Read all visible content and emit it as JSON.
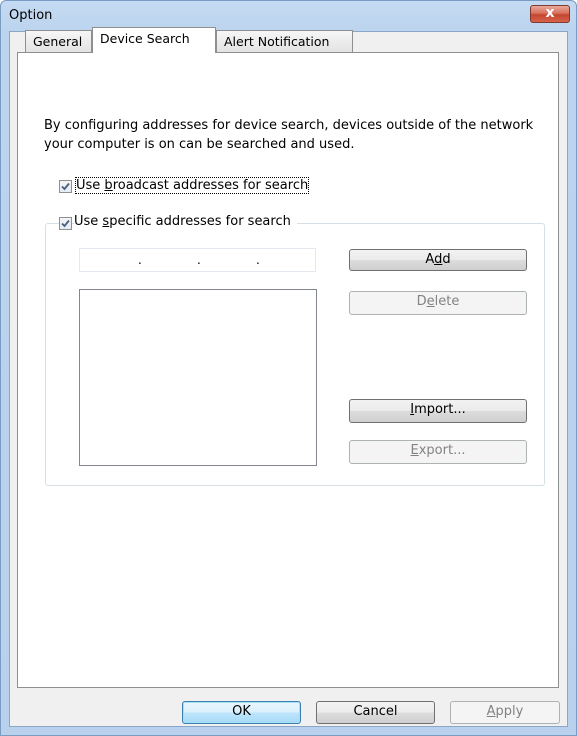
{
  "window": {
    "title": "Option",
    "close_glyph": "x"
  },
  "tabs": [
    {
      "label": "General"
    },
    {
      "label": "Device Search"
    },
    {
      "label": "Alert Notification"
    }
  ],
  "device_search": {
    "description": "By configuring addresses for device search, devices outside of the network your computer is on can be searched and used.",
    "broadcast_checkbox": {
      "label_pre": "Use ",
      "label_accel": "b",
      "label_post": "roadcast addresses for search",
      "checked": true
    },
    "specific_checkbox": {
      "label_pre": "Use ",
      "label_accel": "s",
      "label_post": "pecific addresses for search",
      "checked": true
    },
    "ip_address": {
      "dots": [
        ".",
        ".",
        "."
      ]
    },
    "address_list": [],
    "buttons": {
      "add": {
        "pre": "A",
        "accel": "d",
        "post": "d"
      },
      "delete": {
        "pre": "D",
        "accel": "e",
        "post": "lete"
      },
      "import": {
        "pre": "",
        "accel": "I",
        "post": "mport..."
      },
      "export": {
        "pre": "",
        "accel": "E",
        "post": "xport..."
      }
    }
  },
  "footer": {
    "ok": "OK",
    "cancel": "Cancel",
    "apply": {
      "pre": "",
      "accel": "A",
      "post": "pply"
    }
  },
  "colors": {
    "title_bar": "#bcd4ee",
    "close_button": "#c44730",
    "default_button_border": "#3c7fb1"
  }
}
